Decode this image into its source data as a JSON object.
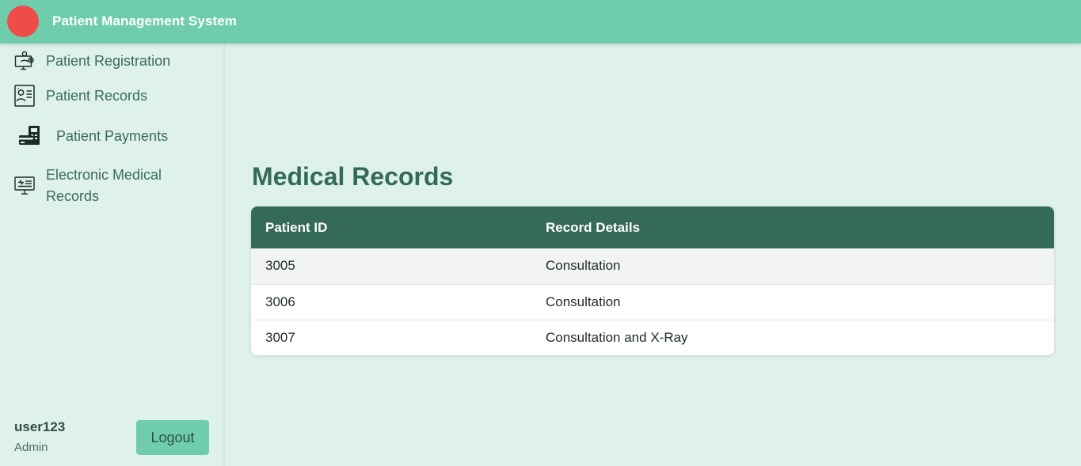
{
  "app": {
    "title": "Patient Management System",
    "colors": {
      "accent": "#6fcdac",
      "table_header": "#356959",
      "logo": "#f04b4b"
    }
  },
  "sidebar": {
    "items": [
      {
        "label": "Patient Registration",
        "icon": "monitor-registration-icon"
      },
      {
        "label": "Patient Records",
        "icon": "patient-id-card-icon"
      },
      {
        "label": "Patient Payments",
        "icon": "payment-card-icon"
      },
      {
        "label": "Electronic Medical Records",
        "icon": "medical-monitor-icon"
      }
    ],
    "user": {
      "name": "user123",
      "role": "Admin"
    },
    "logout_label": "Logout"
  },
  "main": {
    "title": "Medical Records",
    "table": {
      "headers": [
        "Patient ID",
        "Record Details"
      ],
      "rows": [
        [
          "3005",
          "Consultation"
        ],
        [
          "3006",
          "Consultation"
        ],
        [
          "3007",
          "Consultation and X-Ray"
        ]
      ]
    }
  }
}
